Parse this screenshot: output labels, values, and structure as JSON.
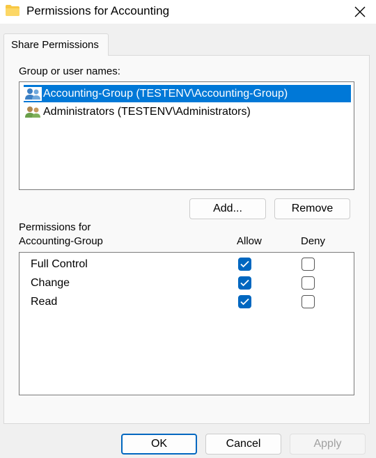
{
  "window": {
    "title": "Permissions for Accounting",
    "icon": "folder-icon",
    "close_icon": "close-icon"
  },
  "tab": {
    "label": "Share Permissions"
  },
  "groups": {
    "label": "Group or user names:",
    "items": [
      {
        "label": "Accounting-Group (TESTENV\\Accounting-Group)",
        "icon": "user-group-icon",
        "selected": true
      },
      {
        "label": "Administrators (TESTENV\\Administrators)",
        "icon": "user-group-icon",
        "selected": false
      }
    ]
  },
  "buttons": {
    "add": "Add...",
    "remove": "Remove"
  },
  "permissions": {
    "label_line1": "Permissions for",
    "label_line2": "Accounting-Group",
    "allow_header": "Allow",
    "deny_header": "Deny",
    "rows": [
      {
        "name": "Full Control",
        "allow": true,
        "deny": false
      },
      {
        "name": "Change",
        "allow": true,
        "deny": false
      },
      {
        "name": "Read",
        "allow": true,
        "deny": false
      }
    ]
  },
  "footer": {
    "ok": "OK",
    "cancel": "Cancel",
    "apply": "Apply"
  },
  "colors": {
    "accent": "#0078d7",
    "checkbox": "#0067c0"
  }
}
